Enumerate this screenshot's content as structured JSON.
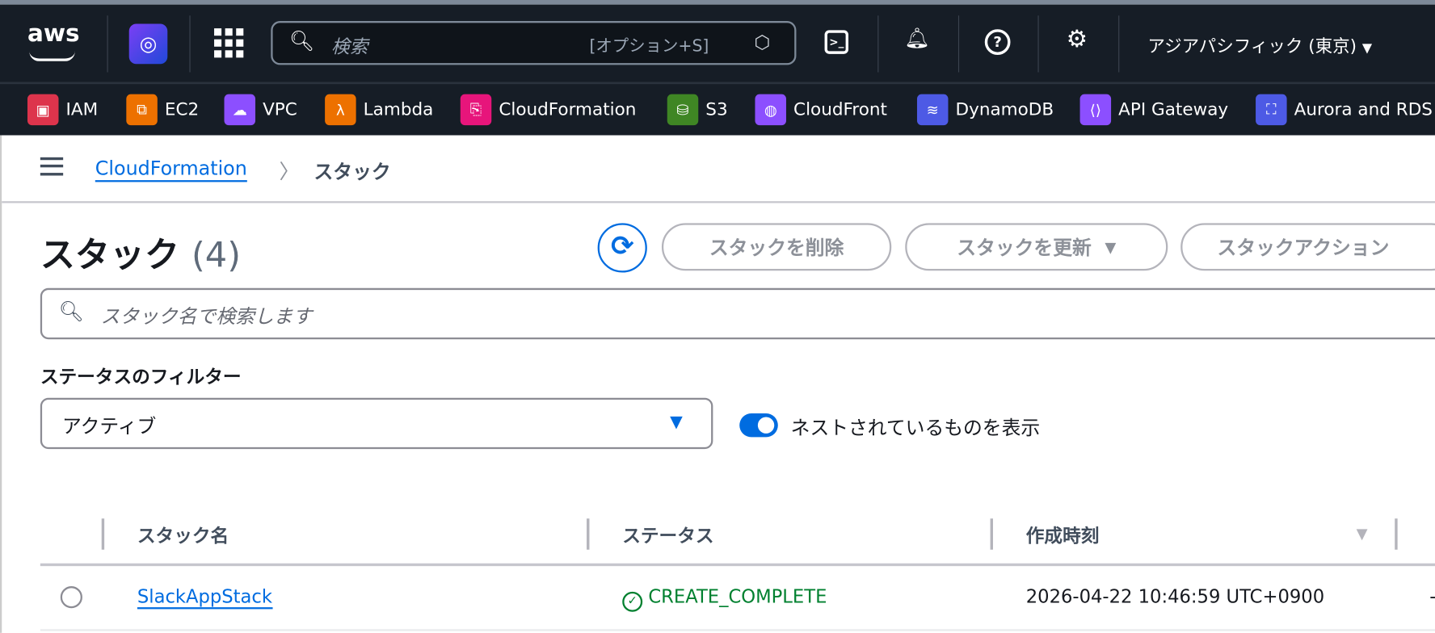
{
  "nav": {
    "logo": "aws",
    "search_placeholder": "検索",
    "search_shortcut": "[オプション+S]",
    "region": "アジアパシフィック (東京)",
    "icons": [
      "q-icon",
      "apps-grid-icon",
      "search-icon",
      "cloudshell-icon",
      "bell-icon",
      "help-icon",
      "gear-icon"
    ]
  },
  "services": [
    {
      "label": "IAM",
      "color": "#dd344c"
    },
    {
      "label": "EC2",
      "color": "#ed7100"
    },
    {
      "label": "VPC",
      "color": "#8c4fff"
    },
    {
      "label": "Lambda",
      "color": "#ed7100"
    },
    {
      "label": "CloudFormation",
      "color": "#e7157b"
    },
    {
      "label": "S3",
      "color": "#3f8624"
    },
    {
      "label": "CloudFront",
      "color": "#8c4fff"
    },
    {
      "label": "DynamoDB",
      "color": "#4d5ae5"
    },
    {
      "label": "API Gateway",
      "color": "#8c4fff"
    },
    {
      "label": "Aurora and RDS",
      "color": "#4d5ae5"
    }
  ],
  "breadcrumb": {
    "parent": "CloudFormation",
    "current": "スタック"
  },
  "page": {
    "title": "スタック",
    "count": "(4)",
    "delete_label": "スタックを削除",
    "update_label": "スタックを更新",
    "actions_label": "スタックアクション",
    "search_placeholder": "スタック名で検索します",
    "filter_label": "ステータスのフィルター",
    "filter_value": "アクティブ",
    "nested_toggle_label": "ネストされているものを表示",
    "nested_toggle_on": true
  },
  "table": {
    "columns": [
      "スタック名",
      "ステータス",
      "作成時刻"
    ],
    "rows": [
      {
        "name": "SlackAppStack",
        "status": "CREATE_COMPLETE",
        "created": "2026-04-22 10:46:59 UTC+0900",
        "extra": "-"
      }
    ]
  },
  "colors": {
    "accent": "#006ce0",
    "success": "#00802f",
    "nav_bg": "#161d26"
  }
}
